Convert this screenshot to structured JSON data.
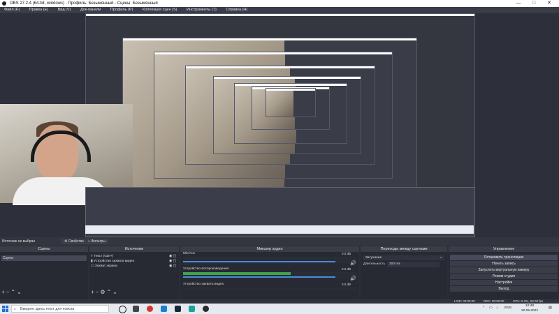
{
  "window": {
    "title": "OBS 27.2.4 (64-bit, windows) - Профиль: Безымянный - Сцены: Безымянный",
    "controls": [
      "—",
      "□",
      "✕"
    ]
  },
  "menu": [
    "Файл (F)",
    "Правка (E)",
    "Вид (V)",
    "Док-панели",
    "Профиль (P)",
    "Коллекция сцен (S)",
    "Инструменты (T)",
    "Справка (H)"
  ],
  "source_bar": {
    "no_source": "Источник не выбран",
    "properties_label": "Свойства",
    "filters_label": "Фильтры"
  },
  "docks": {
    "scenes": {
      "header": "Сцены",
      "items": [
        "Сцена"
      ]
    },
    "sources": {
      "header": "Источники",
      "items": [
        {
          "label": "Текст (GDI+)",
          "icon": "text-icon"
        },
        {
          "label": "Устройство захвата видео",
          "icon": "camera-icon"
        },
        {
          "label": "Захват экрана",
          "icon": "monitor-icon"
        }
      ]
    },
    "mixer": {
      "header": "Микшер аудио",
      "channels": [
        {
          "name": "Mic/Aux",
          "db": "0.0 dB",
          "level": 0.0
        },
        {
          "name": "Устройство воспроизведения",
          "db": "0.0 dB",
          "level": 0.62
        },
        {
          "name": "Устройство захвата видео",
          "db": "0.0 dB",
          "level": 0.0
        }
      ]
    },
    "transitions": {
      "header": "Переходы между сценами",
      "transition": "Затухание",
      "duration_label": "Длительность",
      "duration_value": "300 ms"
    },
    "controls": {
      "header": "Управление",
      "buttons": [
        "Остановить трансляцию",
        "Начать запись",
        "Запустить виртуальную камеру",
        "Режим студии",
        "Настройки",
        "Выход"
      ]
    }
  },
  "status": {
    "live": "LIVE: 00:00:00",
    "rec": "REC: 00:00:00",
    "cpu": "CPU: 5.3%, 60.00 fps"
  },
  "taskbar": {
    "search_placeholder": "Введите здесь текст для поиска",
    "lang": "ENG",
    "time": "10:48",
    "date": "20.05.2022"
  }
}
